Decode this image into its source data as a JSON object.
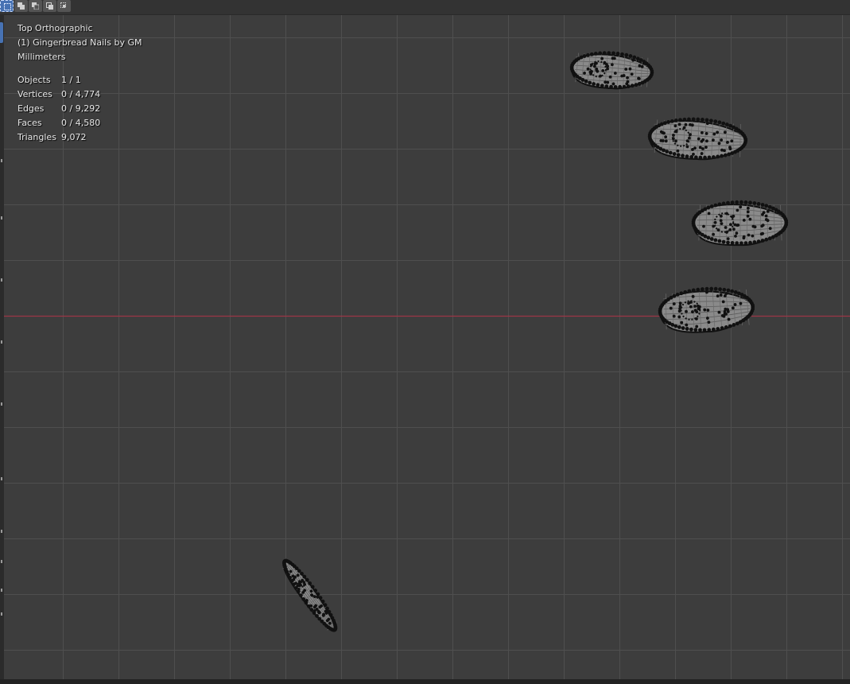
{
  "header": {
    "select_modes": [
      {
        "name": "select-box-mode",
        "active": true
      },
      {
        "name": "select-extend-mode",
        "active": false
      },
      {
        "name": "select-subtract-mode",
        "active": false
      },
      {
        "name": "select-invert-mode",
        "active": false
      },
      {
        "name": "select-intersect-mode",
        "active": false
      }
    ]
  },
  "viewport": {
    "view_name": "Top Orthographic",
    "collection_label": "(1) Gingerbread Nails by GM",
    "units": "Millimeters",
    "stats": {
      "objects_label": "Objects",
      "objects_value": "1 / 1",
      "vertices_label": "Vertices",
      "vertices_value": "0 / 4,774",
      "edges_label": "Edges",
      "edges_value": "0 / 9,292",
      "faces_label": "Faces",
      "faces_value": "0 / 4,580",
      "triangles_label": "Triangles",
      "triangles_value": "9,072"
    }
  },
  "colors": {
    "background": "#3d3d3d",
    "grid_line": "#4f4f4f",
    "x_axis": "#9c3646",
    "mesh_fill": "#8a8a8a",
    "vertex": "#111111",
    "active_accent": "#4772b3"
  },
  "meshes": [
    {
      "name": "nail-mesh-1"
    },
    {
      "name": "nail-mesh-2"
    },
    {
      "name": "nail-mesh-3"
    },
    {
      "name": "nail-mesh-4"
    },
    {
      "name": "nail-mesh-5"
    }
  ]
}
